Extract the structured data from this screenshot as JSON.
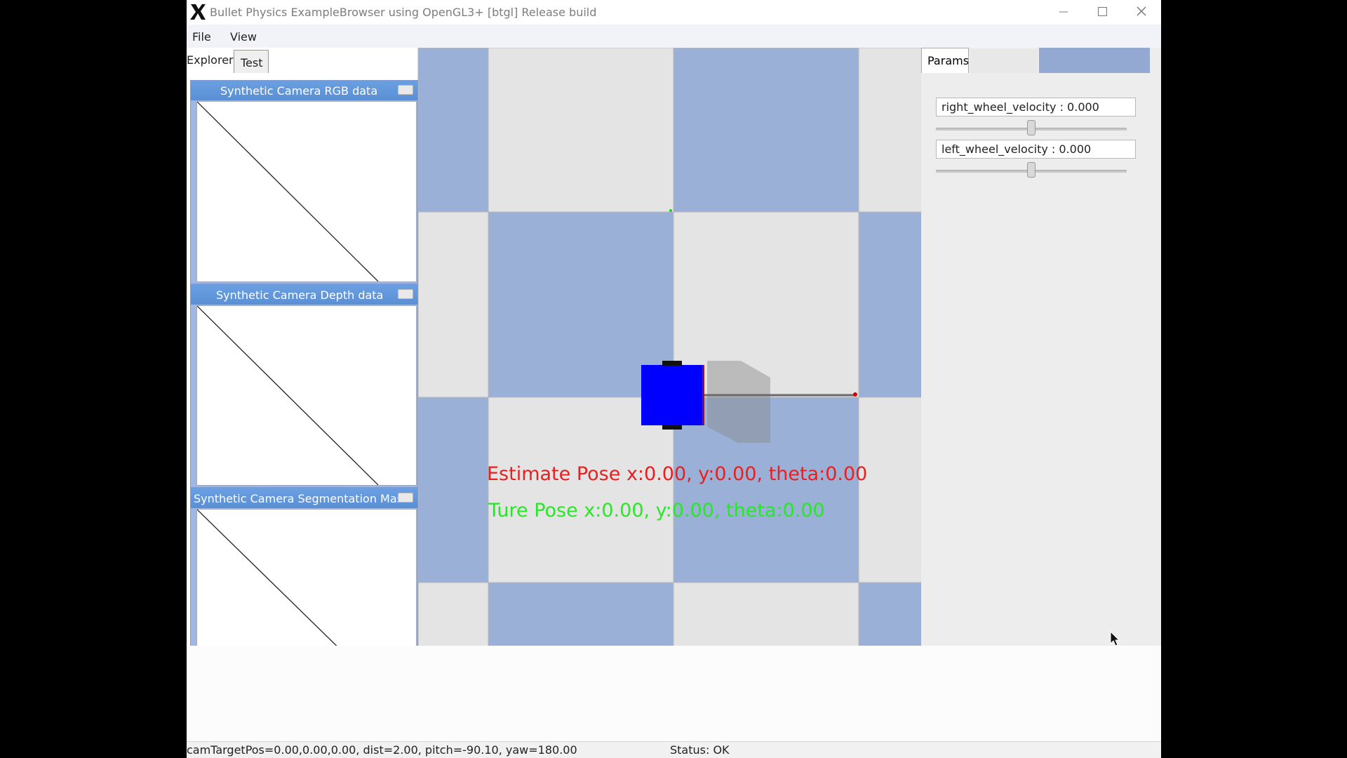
{
  "window": {
    "title": "Bullet Physics ExampleBrowser using OpenGL3+ [btgl] Release build",
    "menu": [
      "File",
      "View"
    ]
  },
  "left_panel": {
    "tabs": [
      "Explorer",
      "Test"
    ],
    "camera_windows": [
      {
        "title": "Synthetic Camera RGB data"
      },
      {
        "title": "Synthetic Camera Depth data"
      },
      {
        "title": "Synthetic Camera Segmentation Mask"
      }
    ]
  },
  "scene": {
    "estimate_pose": "Estimate Pose x:0.00, y:0.00, theta:0.00",
    "true_pose": "Ture Pose x:0.00, y:0.00, theta:0.00",
    "estimate_color": "#e82020",
    "true_color": "#27e827",
    "tile_blue": "#9ab0d6",
    "tile_gray": "#e4e4e4",
    "robot_color": "#0000ff"
  },
  "params_panel": {
    "tab_label": "Params",
    "params": [
      {
        "label": "right_wheel_velocity : 0.000",
        "value": 0.0
      },
      {
        "label": "left_wheel_velocity : 0.000",
        "value": 0.0
      }
    ]
  },
  "status": {
    "left": "camTargetPos=0.00,0.00,0.00, dist=2.00, pitch=-90.10, yaw=180.00",
    "right": "Status: OK"
  }
}
